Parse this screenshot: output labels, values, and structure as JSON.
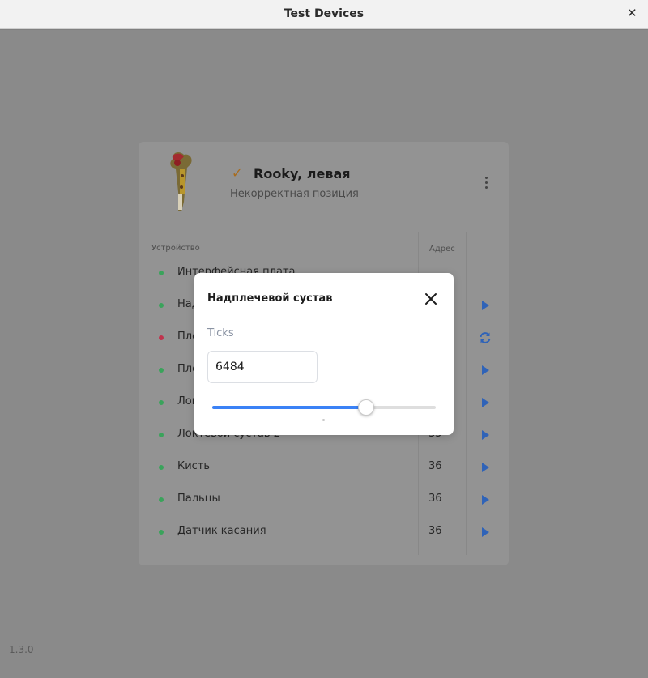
{
  "window": {
    "title": "Test Devices"
  },
  "app": {
    "version": "1.3.0"
  },
  "device_card": {
    "name": "Rooky, левая",
    "status": "Некорректная позиция",
    "table": {
      "col_device": "Устройство",
      "col_address": "Адрес",
      "rows": [
        {
          "label": "Интерфейсная плата",
          "address": "",
          "status": "ok",
          "action": "none"
        },
        {
          "label": "Надплечевой сустав",
          "address": "",
          "status": "ok",
          "action": "play"
        },
        {
          "label": "Плечевой сустав",
          "address": "",
          "status": "error",
          "action": "refresh"
        },
        {
          "label": "Плечевой сустав 2",
          "address": "",
          "status": "ok",
          "action": "play"
        },
        {
          "label": "Локтевой сустав",
          "address": "",
          "status": "ok",
          "action": "play"
        },
        {
          "label": "Локтевой сустав 2",
          "address": "35",
          "status": "ok",
          "action": "play"
        },
        {
          "label": "Кисть",
          "address": "36",
          "status": "ok",
          "action": "play"
        },
        {
          "label": "Пальцы",
          "address": "36",
          "status": "ok",
          "action": "play"
        },
        {
          "label": "Датчик касания",
          "address": "36",
          "status": "ok",
          "action": "play"
        }
      ]
    }
  },
  "dialog": {
    "title": "Надплечевой сустав",
    "field_label": "Ticks",
    "ticks_value": "6484",
    "slider_fraction": 0.69
  },
  "colors": {
    "accent": "#3b82f6",
    "status_ok": "#3aa35b",
    "status_error": "#c0334d",
    "check": "#a86c1f",
    "action_icon": "#2f63b8"
  }
}
